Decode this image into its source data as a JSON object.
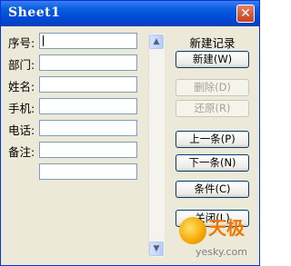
{
  "window": {
    "title": "Sheet1"
  },
  "fields": [
    {
      "label": "序号:",
      "value": ""
    },
    {
      "label": "部门:",
      "value": ""
    },
    {
      "label": "姓名:",
      "value": ""
    },
    {
      "label": "手机:",
      "value": ""
    },
    {
      "label": "电话:",
      "value": ""
    },
    {
      "label": "备注:",
      "value": ""
    },
    {
      "label": "",
      "value": ""
    }
  ],
  "scrollbar": {
    "up_icon": "▲",
    "down_icon": "▼"
  },
  "status": {
    "new_record": "新建记录"
  },
  "buttons": {
    "new": "新建(W)",
    "delete": "删除(D)",
    "restore": "还原(R)",
    "prev": "上一条(P)",
    "next": "下一条(N)",
    "criteria": "条件(C)",
    "close": "关闭(L)"
  },
  "watermark": {
    "brand": "天极",
    "url": "yesky.com"
  }
}
